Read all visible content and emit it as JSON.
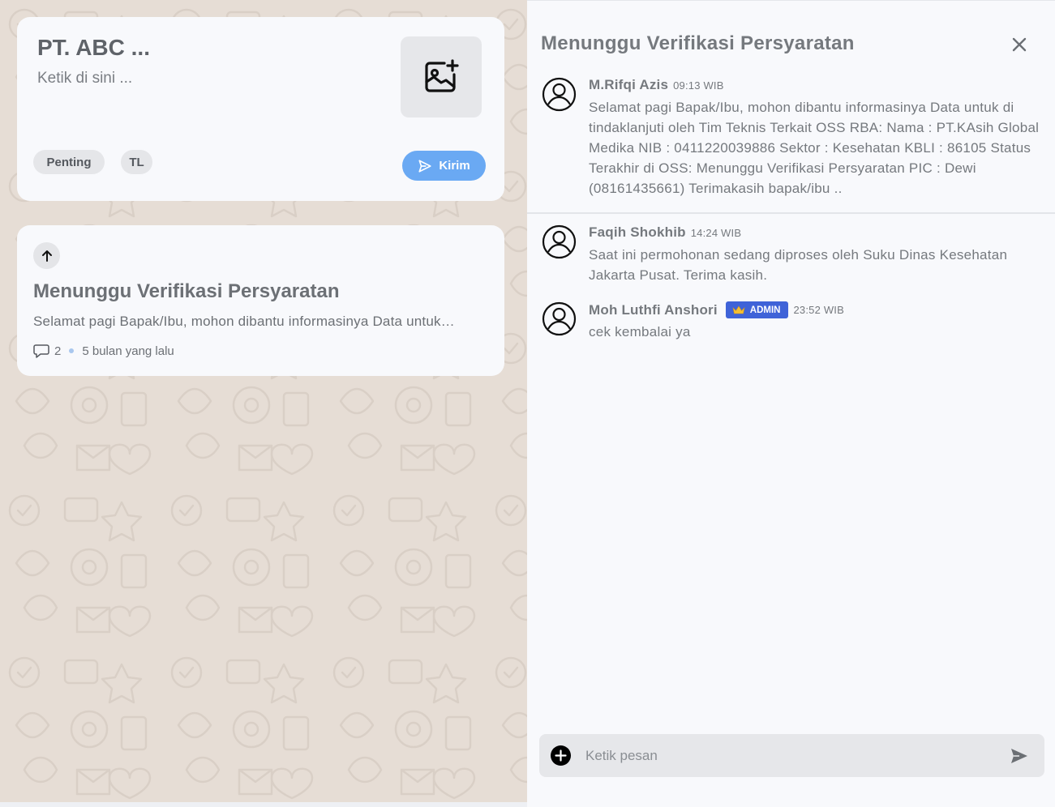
{
  "post_form": {
    "title": "PT. ABC ...",
    "input_placeholder": "Ketik di sini ...",
    "tags": [
      "Penting",
      "TL"
    ],
    "send_label": "Kirim"
  },
  "thread_card": {
    "title": "Menunggu Verifikasi Persyaratan",
    "preview": "Selamat pagi Bapak/Ibu, mohon dibantu informasinya Data untuk di tindaklanjuti oleh Tim Teknis Terkait OSS RBA",
    "comment_count": "2",
    "time_ago": "5 bulan yang lalu"
  },
  "detail": {
    "title": "Menunggu Verifikasi Persyaratan",
    "comments": [
      {
        "name": "M.Rifqi Azis",
        "time": "09:13 WIB",
        "text": "Selamat pagi Bapak/Ibu, mohon dibantu informasinya Data untuk di tindaklanjuti oleh Tim Teknis Terkait OSS RBA: Nama : PT.KAsih Global Medika NIB : 0411220039886 Sektor : Kesehatan KBLI : 86105 Status Terakhir di OSS: Menunggu Verifikasi Persyaratan PIC : Dewi (08161435661) Terimakasih bapak/ibu .."
      },
      {
        "name": "Faqih Shokhib",
        "time": "14:24 WIB",
        "text": "Saat ini permohonan sedang diproses oleh Suku Dinas Kesehatan Jakarta Pusat. Terima kasih."
      },
      {
        "name": "Moh Luthfi Anshori",
        "badge": "ADMIN",
        "time": "23:52 WIB",
        "text": "cek kembalai ya"
      }
    ],
    "composer_placeholder": "Ketik pesan"
  },
  "colors": {
    "accent_blue": "#6aa9f3",
    "admin_badge": "#3f63d8",
    "background_left": "#e6ddd5",
    "panel_bg": "#f8f9fc"
  }
}
